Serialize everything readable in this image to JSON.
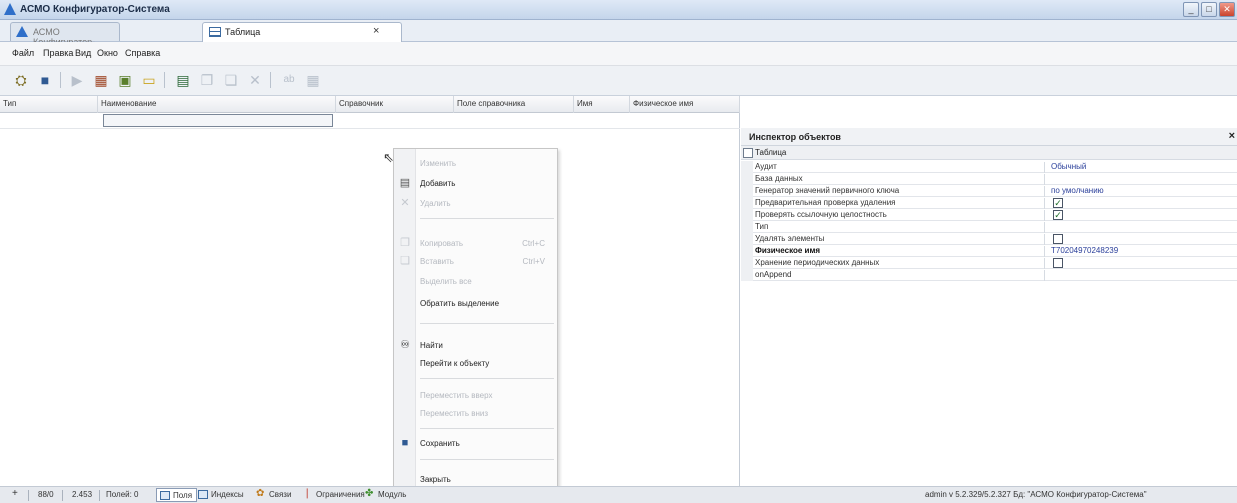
{
  "window": {
    "title": "АСМО Конфигуратор-Система",
    "minimize": "_",
    "maximize": "□",
    "close": "✕"
  },
  "tabs": [
    {
      "label": "АСМО Конфигуратор-Сист"
    },
    {
      "label": "Таблица"
    }
  ],
  "tab_close": "×",
  "menu": [
    "Файл",
    "Правка",
    "Вид",
    "Окно",
    "Справка"
  ],
  "toolbar_icons": [
    "structure-icon",
    "save-icon",
    "play-icon",
    "module-icon",
    "form-icon",
    "comment-icon",
    "grid-icon",
    "copy-icon",
    "paste-icon",
    "delete-icon",
    "text-icon",
    "table-icon"
  ],
  "grid": {
    "columns": [
      "Тип",
      "Наименование",
      "Справочник",
      "Поле справочника",
      "Имя",
      "Физическое имя"
    ]
  },
  "context_menu": {
    "items": [
      {
        "label": "Изменить",
        "enabled": false,
        "icon": ""
      },
      {
        "label": "Добавить",
        "enabled": true,
        "icon": "add-icon"
      },
      {
        "label": "Удалить",
        "enabled": false,
        "icon": "delete-icon"
      },
      {
        "label": "Копировать",
        "shortcut": "Ctrl+C",
        "enabled": false,
        "icon": "copy-icon"
      },
      {
        "label": "Вставить",
        "shortcut": "Ctrl+V",
        "enabled": false,
        "icon": "paste-icon"
      },
      {
        "label": "Выделить все",
        "enabled": false,
        "icon": ""
      },
      {
        "label": "Обратить выделение",
        "enabled": true,
        "icon": ""
      },
      {
        "label": "Найти",
        "enabled": true,
        "icon": "binoculars-icon"
      },
      {
        "label": "Перейти к объекту",
        "enabled": true,
        "icon": ""
      },
      {
        "label": "Переместить вверх",
        "enabled": false,
        "icon": ""
      },
      {
        "label": "Переместить вниз",
        "enabled": false,
        "icon": ""
      },
      {
        "label": "Сохранить",
        "enabled": true,
        "icon": "save-icon"
      },
      {
        "label": "Закрыть",
        "enabled": true,
        "icon": ""
      }
    ]
  },
  "inspector": {
    "title": "Инспектор объектов",
    "close": "×",
    "category": "Таблица",
    "properties": [
      {
        "name": "Аудит",
        "value": "Обычный"
      },
      {
        "name": "База данных",
        "value": ""
      },
      {
        "name": "Генератор значений первичного ключа",
        "value": "по умолчанию"
      },
      {
        "name": "Предварительная проверка удаления",
        "checked": true
      },
      {
        "name": "Проверять ссылочную целостность",
        "checked": true
      },
      {
        "name": "Тип",
        "value": ""
      },
      {
        "name": "Удалять элементы",
        "checked": false
      },
      {
        "name": "Физическое имя",
        "value": "T70204970248239",
        "bold": true
      },
      {
        "name": "Хранение периодических данных",
        "checked": false
      },
      {
        "name": "onAppend",
        "value": ""
      }
    ]
  },
  "statusbar": {
    "add": "+",
    "position": "88/0",
    "size": "2.453",
    "fields_count": "Полей: 0",
    "buttons": [
      {
        "label": "Поля",
        "icon": "fields-icon"
      },
      {
        "label": "Индексы",
        "icon": "indexes-icon"
      },
      {
        "label": "Связи",
        "icon": "links-icon"
      },
      {
        "label": "Ограничения",
        "icon": "constraints-icon"
      },
      {
        "label": "Модуль",
        "icon": "module-icon"
      }
    ],
    "right": "admin  v 5.2.329/5.2.327  Бд: \"АСМО Конфигуратор-Система\""
  },
  "colors": {
    "accent": "#2f6fc9",
    "value_text": "#2a3f9a",
    "check": "#1f6e2a"
  }
}
